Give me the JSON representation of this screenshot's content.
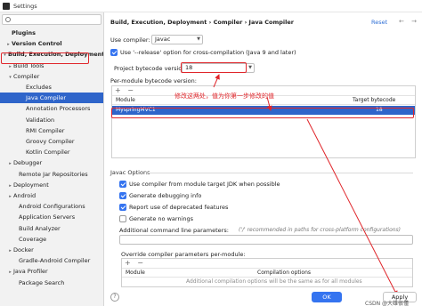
{
  "window": {
    "title": "Settings"
  },
  "sidebar": {
    "items": [
      {
        "label": "Plugins",
        "arrow": "",
        "bold": true
      },
      {
        "label": "Version Control",
        "arrow": "▸",
        "bold": true
      },
      {
        "label": "Build, Execution, Deployment",
        "arrow": "▾",
        "bold": true
      },
      {
        "label": "Build Tools",
        "arrow": "▸",
        "bold": false
      },
      {
        "label": "Compiler",
        "arrow": "▾",
        "bold": false
      },
      {
        "label": "Excludes",
        "arrow": "",
        "bold": false
      },
      {
        "label": "Java Compiler",
        "arrow": "",
        "bold": false
      },
      {
        "label": "Annotation Processors",
        "arrow": "",
        "bold": false
      },
      {
        "label": "Validation",
        "arrow": "",
        "bold": false
      },
      {
        "label": "RMI Compiler",
        "arrow": "",
        "bold": false
      },
      {
        "label": "Groovy Compiler",
        "arrow": "",
        "bold": false
      },
      {
        "label": "Kotlin Compiler",
        "arrow": "",
        "bold": false
      },
      {
        "label": "Debugger",
        "arrow": "▸",
        "bold": false
      },
      {
        "label": "Remote Jar Repositories",
        "arrow": "",
        "bold": false
      },
      {
        "label": "Deployment",
        "arrow": "▸",
        "bold": false
      },
      {
        "label": "Android",
        "arrow": "▸",
        "bold": false
      },
      {
        "label": "Android Configurations",
        "arrow": "",
        "bold": false
      },
      {
        "label": "Application Servers",
        "arrow": "",
        "bold": false
      },
      {
        "label": "Build Analyzer",
        "arrow": "",
        "bold": false
      },
      {
        "label": "Coverage",
        "arrow": "",
        "bold": false
      },
      {
        "label": "Docker",
        "arrow": "▸",
        "bold": false
      },
      {
        "label": "Gradle-Android Compiler",
        "arrow": "",
        "bold": false
      },
      {
        "label": "Java Profiler",
        "arrow": "▸",
        "bold": false
      },
      {
        "label": "Package Search",
        "arrow": "",
        "bold": false
      }
    ]
  },
  "main": {
    "breadcrumb": "Build, Execution, Deployment  ›  Compiler  ›  Java Compiler",
    "reset": "Reset",
    "nav_arrows": "← →",
    "use_compiler_label": "Use compiler:",
    "use_compiler_value": "Javac",
    "release_option_label": "Use '--release' option for cross-compilation (Java 9 and later)",
    "project_bytecode_label": "Project bytecode version:",
    "project_bytecode_value": "18",
    "per_module_label": "Per-module bytecode version:",
    "table": {
      "toolbar": [
        "+",
        "−"
      ],
      "columns": [
        "Module",
        "Target bytecode version"
      ],
      "rows": [
        {
          "module": "MyspringMVC1",
          "version": "18"
        }
      ]
    },
    "annotation": "修改这两处，值为你第一步修改的值",
    "javac_options_title": "Javac Options",
    "options": [
      {
        "label": "Use compiler from module target JDK when possible",
        "checked": true
      },
      {
        "label": "Generate debugging info",
        "checked": true
      },
      {
        "label": "Report use of deprecated features",
        "checked": true
      },
      {
        "label": "Generate no warnings",
        "checked": false
      }
    ],
    "additional_params_label": "Additional command line parameters:",
    "additional_params_hint": "('/' recommended in paths for cross-platform configurations)",
    "override_label": "Override compiler parameters per-module:",
    "override_table": {
      "toolbar": [
        "+",
        "−"
      ],
      "columns": [
        "Module",
        "Compilation options"
      ],
      "empty_text": "Additional compilation options will be the same as for all modules"
    }
  },
  "footer": {
    "help": "?",
    "ok": "OK",
    "apply": "Apply",
    "watermark": "CSDN @大雄很懂"
  }
}
